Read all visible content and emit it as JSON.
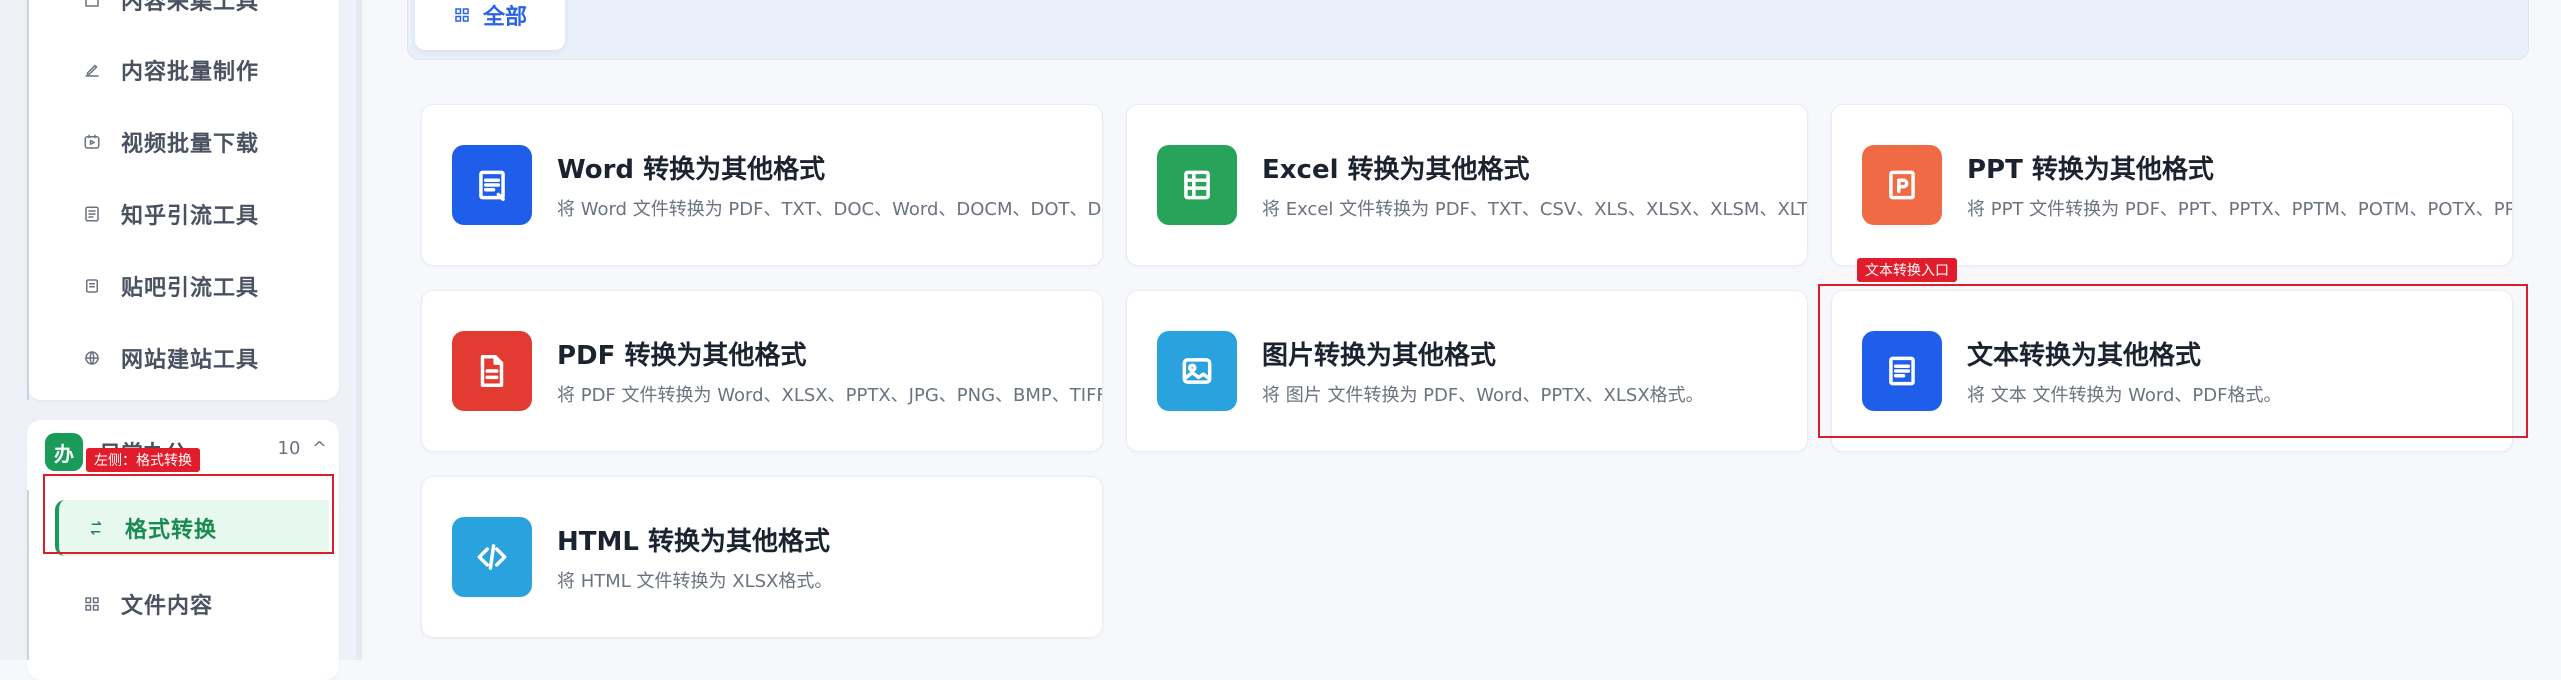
{
  "sidebar": {
    "items": [
      {
        "label": "内容采集工具",
        "icon": "collect-icon"
      },
      {
        "label": "内容批量制作",
        "icon": "pencil-icon"
      },
      {
        "label": "视频批量下载",
        "icon": "video-icon"
      },
      {
        "label": "知乎引流工具",
        "icon": "zhihu-icon"
      },
      {
        "label": "贴吧引流工具",
        "icon": "doc-icon"
      },
      {
        "label": "网站建站工具",
        "icon": "globe-icon"
      }
    ],
    "group": {
      "badge": "办",
      "title": "日常办公",
      "count": "10",
      "chevron": "^",
      "items": [
        {
          "label": "格式转换",
          "icon": "swap-icon"
        },
        {
          "label": "文件内容",
          "icon": "grid-icon"
        }
      ]
    },
    "annotation": "左侧：格式转换"
  },
  "filter": {
    "all_label": "全部"
  },
  "annotation_text": "文本转换入口",
  "cards": [
    {
      "title": "Word 转换为其他格式",
      "desc": "将 Word 文件转换为 PDF、TXT、DOC、Word、DOCM、DOT、DOTX",
      "color": "#1f5eea"
    },
    {
      "title": "Excel 转换为其他格式",
      "desc": "将 Excel 文件转换为 PDF、TXT、CSV、XLS、XLSX、XLSM、XLTX、XLT",
      "color": "#27a35a"
    },
    {
      "title": "PPT 转换为其他格式",
      "desc": "将 PPT 文件转换为 PDF、PPT、PPTX、PPTM、POTM、POTX、PPS、PPSX",
      "color": "#f06a45"
    },
    {
      "title": "PDF 转换为其他格式",
      "desc": "将 PDF 文件转换为 Word、XLSX、PPTX、JPG、PNG、BMP、TIFF格式",
      "color": "#e23b32"
    },
    {
      "title": "图片转换为其他格式",
      "desc": "将 图片 文件转换为 PDF、Word、PPTX、XLSX格式。",
      "color": "#2aa2de"
    },
    {
      "title": "文本转换为其他格式",
      "desc": "将 文本 文件转换为 Word、PDF格式。",
      "color": "#1f5eea"
    },
    {
      "title": "HTML 转换为其他格式",
      "desc": "将 HTML 文件转换为 XLSX格式。",
      "color": "#2aa2de"
    }
  ]
}
